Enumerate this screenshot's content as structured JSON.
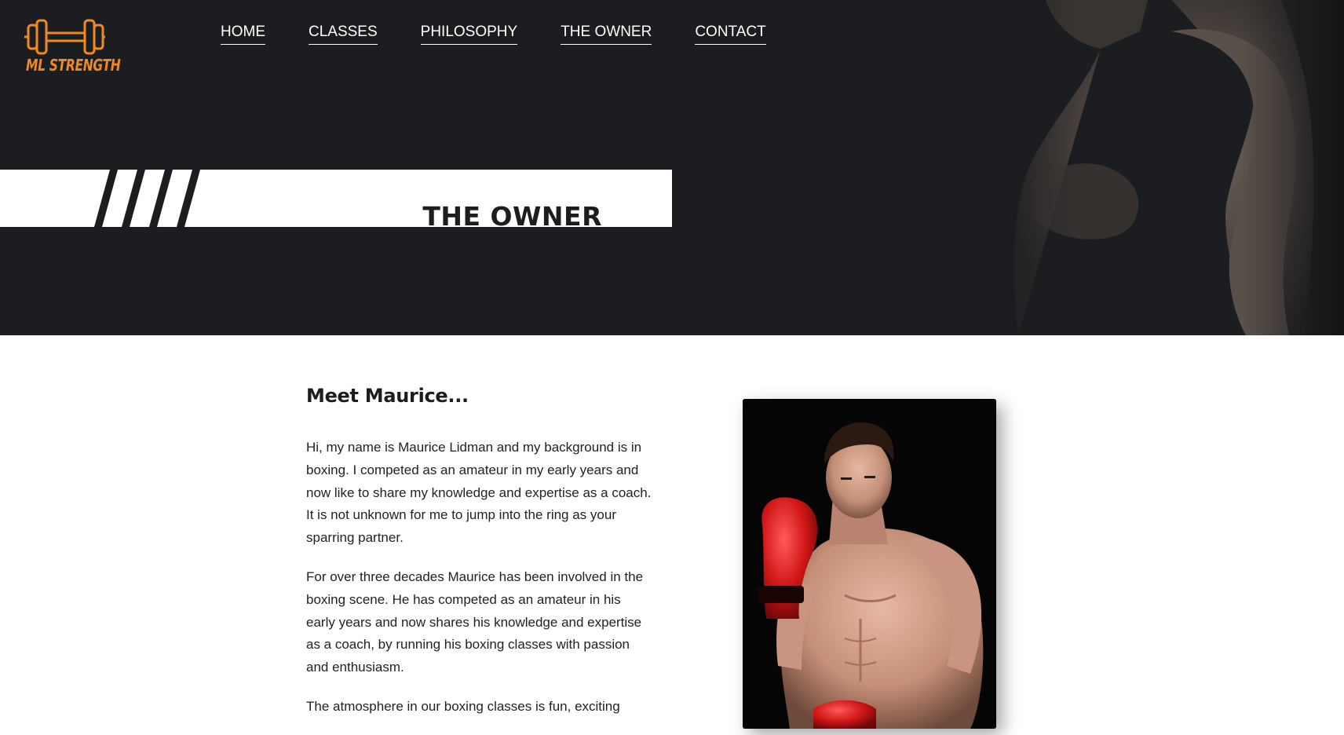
{
  "brand": {
    "logo_text": "ML STRENGTH",
    "accent_color": "#f08a1c",
    "icon": "dumbbell-icon"
  },
  "nav": {
    "items": [
      {
        "label": "HOME"
      },
      {
        "label": "CLASSES"
      },
      {
        "label": "PHILOSOPHY"
      },
      {
        "label": "THE OWNER"
      },
      {
        "label": "CONTACT"
      }
    ]
  },
  "hero": {
    "title": "THE OWNER",
    "background_color": "#1b1d20"
  },
  "main": {
    "heading": "Meet Maurice...",
    "paragraphs": [
      "Hi, my name is Maurice Lidman and my background is in boxing. I competed as an amateur in my early years and now like to share my knowledge and expertise as a coach. It is not unknown for me to jump into the ring as your sparring partner.",
      "For over three decades Maurice has been involved in the boxing scene. He has competed as an amateur in his early years and now shares his knowledge and expertise as a coach, by running his boxing classes with passion and enthusiasm.",
      "The atmosphere in our boxing classes is fun, exciting"
    ]
  }
}
